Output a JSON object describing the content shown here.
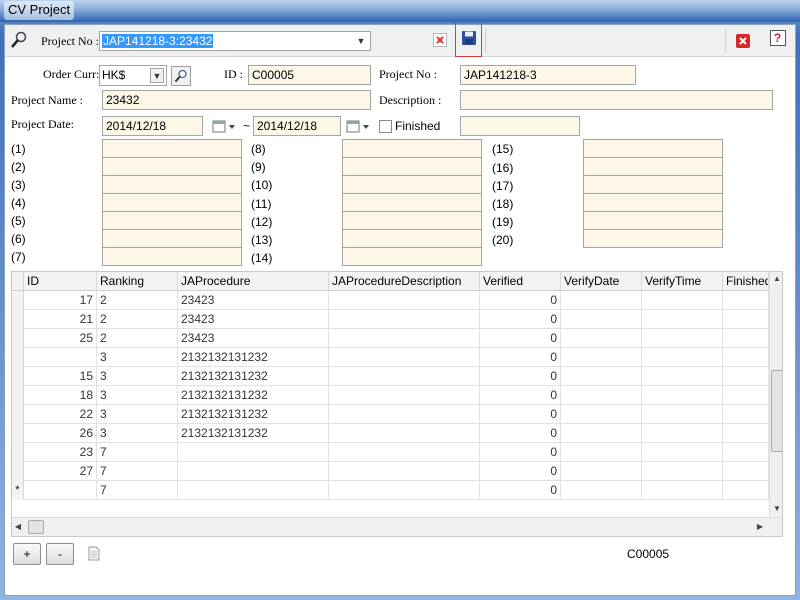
{
  "window": {
    "title": "CV Project"
  },
  "toolbar": {
    "project_no_label": "Project No :",
    "project_no_value": "JAP141218-3:23432"
  },
  "form": {
    "order_curr_label": "Order Curr:",
    "order_curr_value": "HK$",
    "id_label": "ID :",
    "id_value": "C00005",
    "project_no_label": "Project No :",
    "project_no_value": "JAP141218-3",
    "project_name_label": "Project Name :",
    "project_name_value": "23432",
    "description_label": "Description :",
    "description_value": "",
    "project_date_label": "Project Date:",
    "date_from": "2014/12/18",
    "date_sep": "~",
    "date_to": "2014/12/18",
    "finished_label": "Finished",
    "finished_checked": false,
    "extra_value": "",
    "slots_col1": [
      "(1)",
      "(2)",
      "(3)",
      "(4)",
      "(5)",
      "(6)",
      "(7)"
    ],
    "slots_col2": [
      "(8)",
      "(9)",
      "(10)",
      "(11)",
      "(12)",
      "(13)",
      "(14)"
    ],
    "slots_col3": [
      "(15)",
      "(16)",
      "(17)",
      "(18)",
      "(19)",
      "(20)"
    ]
  },
  "grid": {
    "columns": [
      "ID",
      "Ranking",
      "JAProcedure",
      "JAProcedureDescription",
      "Verified",
      "VerifyDate",
      "VerifyTime",
      "Finished"
    ],
    "rows": [
      {
        "indicator": "",
        "id": "17",
        "ranking": "2",
        "procedure": "23423",
        "description": "",
        "verified": "0"
      },
      {
        "indicator": "",
        "id": "21",
        "ranking": "2",
        "procedure": "23423",
        "description": "",
        "verified": "0"
      },
      {
        "indicator": "",
        "id": "25",
        "ranking": "2",
        "procedure": "23423",
        "description": "",
        "verified": "0"
      },
      {
        "indicator": "",
        "id": "",
        "ranking": "3",
        "procedure": "2132132131232",
        "description": "",
        "verified": "0"
      },
      {
        "indicator": "",
        "id": "15",
        "ranking": "3",
        "procedure": "2132132131232",
        "description": "",
        "verified": "0"
      },
      {
        "indicator": "",
        "id": "18",
        "ranking": "3",
        "procedure": "2132132131232",
        "description": "",
        "verified": "0"
      },
      {
        "indicator": "",
        "id": "22",
        "ranking": "3",
        "procedure": "2132132131232",
        "description": "",
        "verified": "0"
      },
      {
        "indicator": "",
        "id": "26",
        "ranking": "3",
        "procedure": "2132132131232",
        "description": "",
        "verified": "0"
      },
      {
        "indicator": "",
        "id": "23",
        "ranking": "7",
        "procedure": "",
        "description": "",
        "verified": "0"
      },
      {
        "indicator": "",
        "id": "27",
        "ranking": "7",
        "procedure": "",
        "description": "",
        "verified": "0"
      },
      {
        "indicator": "*",
        "id": "",
        "ranking": "7",
        "procedure": "",
        "description": "",
        "verified": "0"
      }
    ]
  },
  "footer": {
    "add_label": "+",
    "remove_label": "-",
    "status_text": "C00005"
  },
  "icons": {
    "search": "magnifier-icon",
    "close_small": "red-x-icon",
    "save": "floppy-disk-icon",
    "exit": "red-close-icon",
    "help": "help-icon",
    "calendar": "calendar-icon",
    "document": "document-icon"
  },
  "colors": {
    "field_bg": "#fdf7e7",
    "selection": "#3399ff",
    "save_highlight": "#e0373d"
  }
}
